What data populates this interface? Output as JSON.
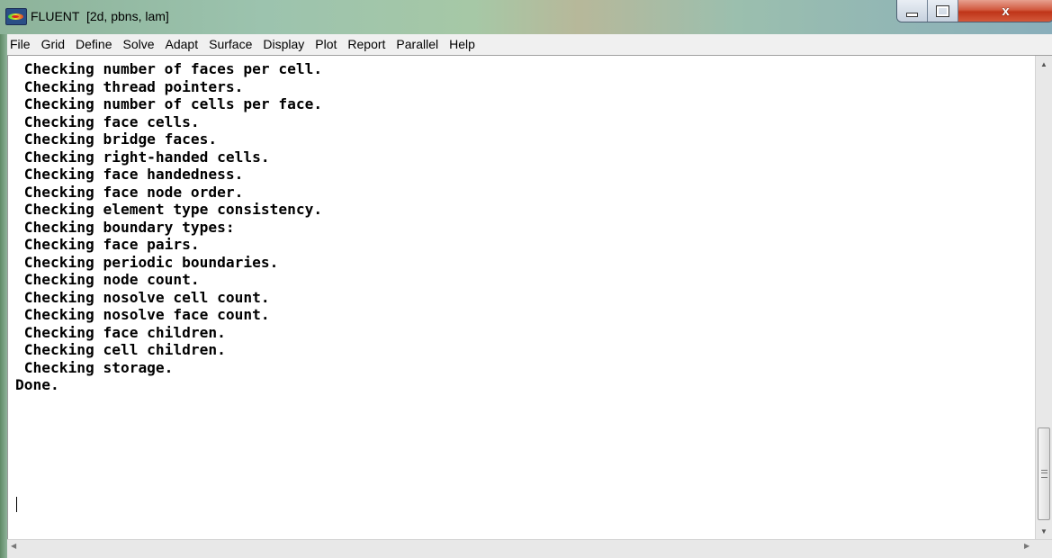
{
  "window": {
    "title": "FLUENT  [2d, pbns, lam]",
    "icon": "fluent-app-icon",
    "controls": {
      "minimize": "–",
      "maximize": "□",
      "close": "x"
    }
  },
  "menu": {
    "items": [
      "File",
      "Grid",
      "Define",
      "Solve",
      "Adapt",
      "Surface",
      "Display",
      "Plot",
      "Report",
      "Parallel",
      "Help"
    ]
  },
  "console": {
    "lines": [
      " Checking number of faces per cell.",
      " Checking thread pointers.",
      " Checking number of cells per face.",
      " Checking face cells.",
      " Checking bridge faces.",
      " Checking right-handed cells.",
      " Checking face handedness.",
      " Checking face node order.",
      " Checking element type consistency.",
      " Checking boundary types:",
      " Checking face pairs.",
      " Checking periodic boundaries.",
      " Checking node count.",
      " Checking nosolve cell count.",
      " Checking nosolve face count.",
      " Checking face children.",
      " Checking cell children.",
      " Checking storage.",
      "Done."
    ]
  },
  "scrollbars": {
    "vertical": {
      "up": "▲",
      "down": "▼"
    },
    "horizontal": {
      "left": "◀",
      "right": "▶"
    }
  }
}
